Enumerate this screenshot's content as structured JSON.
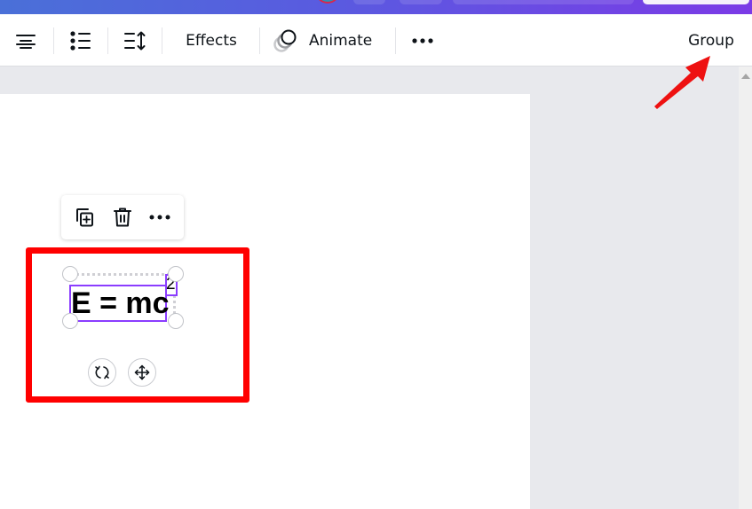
{
  "toolbar": {
    "items": [
      {
        "name": "align-center",
        "icon": "align-center-icon"
      },
      {
        "name": "list",
        "icon": "bulleted-list-icon"
      },
      {
        "name": "spacing",
        "icon": "line-spacing-icon"
      }
    ],
    "effects_label": "Effects",
    "animate_label": "Animate",
    "more_icon": "more-horizontal-icon",
    "group_label": "Group"
  },
  "context_menu": {
    "items": [
      {
        "name": "duplicate",
        "icon": "duplicate-icon"
      },
      {
        "name": "delete",
        "icon": "trash-icon"
      },
      {
        "name": "more",
        "icon": "more-horizontal-icon"
      }
    ]
  },
  "canvas": {
    "equation_text": "E = mc",
    "superscript_text": "2"
  },
  "element_controls": {
    "rotate_icon": "rotate-icon",
    "move_icon": "move-icon"
  },
  "colors": {
    "selection": "#8b3dff",
    "annotation_red": "#ff0000",
    "header_gradient_start": "#4a70d8",
    "header_gradient_end": "#7b3ae6"
  }
}
